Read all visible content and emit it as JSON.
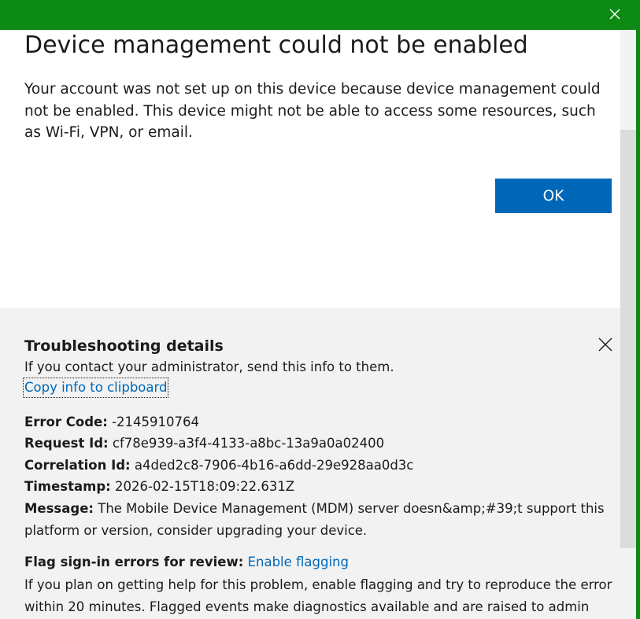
{
  "window": {
    "titlebar_color": "#0d8a14",
    "close_icon": "close-icon"
  },
  "dialog": {
    "title": "Device management could not be enabled",
    "message": "Your account was not set up on this device because device management could not be enabled. This device might not be able to access some resources, such as Wi-Fi, VPN, or email.",
    "ok_label": "OK",
    "accent_color": "#0067b8"
  },
  "troubleshooting": {
    "title": "Troubleshooting details",
    "subtitle": "If you contact your administrator, send this info to them.",
    "copy_link": "Copy info to clipboard",
    "close_icon": "close-icon",
    "fields": {
      "error_code": {
        "label": "Error Code:",
        "value": "-2145910764"
      },
      "request_id": {
        "label": "Request Id:",
        "value": "cf78e939-a3f4-4133-a8bc-13a9a0a02400"
      },
      "correlation_id": {
        "label": "Correlation Id:",
        "value": "a4ded2c8-7906-4b16-a6dd-29e928aa0d3c"
      },
      "timestamp": {
        "label": "Timestamp:",
        "value": "2026-02-15T18:09:22.631Z"
      },
      "message": {
        "label": "Message:",
        "value": "The Mobile Device Management (MDM) server doesn&amp;#39;t support this platform or version, consider upgrading your device."
      }
    },
    "flag": {
      "label": "Flag sign-in errors for review:",
      "link": "Enable flagging",
      "description": "If you plan on getting help for this problem, enable flagging and try to reproduce the error within 20 minutes. Flagged events make diagnostics available and are raised to admin"
    }
  }
}
